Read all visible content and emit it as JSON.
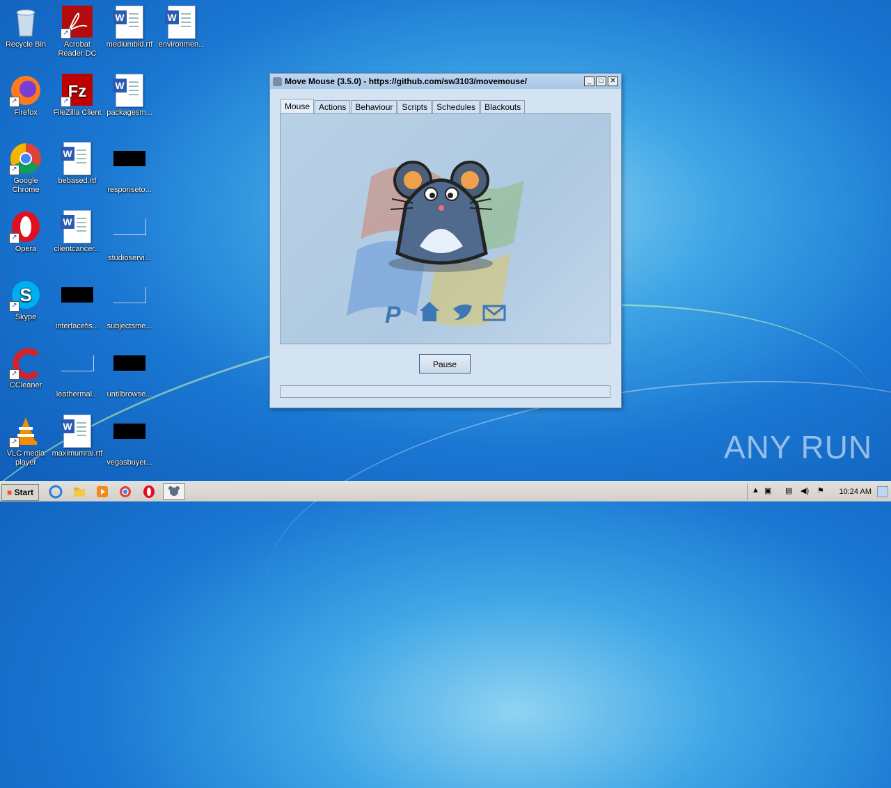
{
  "desktop": {
    "icons": [
      {
        "label": "Recycle Bin"
      },
      {
        "label": "Acrobat Reader DC"
      },
      {
        "label": "mediumbid.rtf"
      },
      {
        "label": "environmen..."
      },
      {
        "label": "Firefox"
      },
      {
        "label": "FileZilla Client"
      },
      {
        "label": "packagesm..."
      },
      {
        "label": "Google Chrome"
      },
      {
        "label": "bebased.rtf"
      },
      {
        "label": "responseto..."
      },
      {
        "label": "Opera"
      },
      {
        "label": "clientcancer..."
      },
      {
        "label": "studioservi..."
      },
      {
        "label": "Skype"
      },
      {
        "label": "interfacefis..."
      },
      {
        "label": "subjectsme..."
      },
      {
        "label": "CCleaner"
      },
      {
        "label": "leathermal..."
      },
      {
        "label": "untilbrowse..."
      },
      {
        "label": "VLC media player"
      },
      {
        "label": "maximumrai.rtf"
      },
      {
        "label": "vegasbuyer..."
      }
    ]
  },
  "window": {
    "title": "Move Mouse (3.5.0) - https://github.com/sw3103/movemouse/",
    "tabs": [
      "Mouse",
      "Actions",
      "Behaviour",
      "Scripts",
      "Schedules",
      "Blackouts"
    ],
    "active_tab": "Mouse",
    "pause_label": "Pause"
  },
  "taskbar": {
    "start_label": "Start",
    "clock": "10:24 AM"
  },
  "watermark": "ANY RUN"
}
